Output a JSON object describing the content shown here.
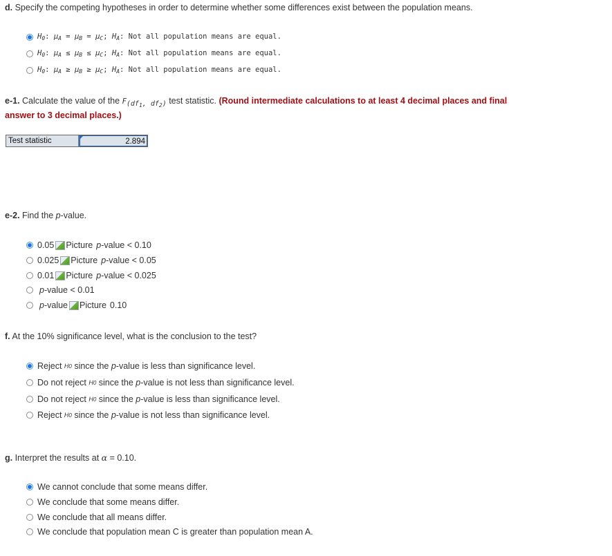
{
  "part_d": {
    "label": "d.",
    "question": " Specify the competing hypotheses in order to determine whether some differences exist between the population means.",
    "options": [
      {
        "h0": "H",
        "op": "=",
        "ha_text": "Not all population means are equal.",
        "selected": true
      },
      {
        "h0": "H",
        "op": "≤",
        "ha_text": "Not all population means are equal.",
        "selected": false
      },
      {
        "h0": "H",
        "op": "≥",
        "ha_text": "Not all population means are equal.",
        "selected": false
      }
    ],
    "null_sub": "0",
    "alt_sub": "A",
    "mu": "μ",
    "groups": [
      "A",
      "B",
      "C"
    ]
  },
  "part_e1": {
    "label": "e-1.",
    "question_pre": " Calculate the value of the ",
    "f_symbol": "F",
    "f_args": "(df",
    "df1_sub": "1",
    "comma": ", df",
    "df2_sub": "2",
    "close": ")",
    "question_post": " test statistic. ",
    "instruction_line1": "(Round intermediate calculations to at least 4 decimal places and final",
    "instruction_line2": "answer to 3 decimal places.)",
    "table_label": "Test statistic",
    "table_value": "2.894"
  },
  "part_e2": {
    "label": "e-2.",
    "question_pre": " Find the ",
    "question_p": "p",
    "question_post": "-value.",
    "picture_alt": "Picture",
    "options": [
      {
        "pre": "0.05",
        "has_pic": true,
        "p": "p",
        "post": "-value < 0.10",
        "selected": true
      },
      {
        "pre": "0.025",
        "has_pic": true,
        "p": "p",
        "post": "-value < 0.05",
        "selected": false
      },
      {
        "pre": "0.01",
        "has_pic": true,
        "p": "p",
        "post": "-value < 0.025",
        "selected": false
      },
      {
        "pre": "",
        "has_pic": false,
        "p": "p",
        "post": "-value < 0.01",
        "selected": false
      },
      {
        "pre": "",
        "has_pic": true,
        "p": "p",
        "post": "-value",
        "tail": "0.10",
        "selected": false
      }
    ]
  },
  "part_f": {
    "label": "f.",
    "question": " At the 10% significance level, what is the conclusion to the test?",
    "options": [
      {
        "pre": "Reject ",
        "mid": " since the ",
        "post": "-value is less than significance level.",
        "selected": true
      },
      {
        "pre": "Do not reject ",
        "mid": " since the ",
        "post": "-value is not less than significance level.",
        "selected": false
      },
      {
        "pre": "Do not reject ",
        "mid": " since the ",
        "post": "-value is less than significance level.",
        "selected": false
      },
      {
        "pre": "Reject ",
        "mid": " since the ",
        "post": "-value is not less than significance level.",
        "selected": false
      }
    ]
  },
  "part_g": {
    "label": "g.",
    "question_pre": " Interpret the results at ",
    "alpha": "α",
    "question_post": " = 0.10.",
    "options": [
      {
        "text": "We cannot conclude that some means differ.",
        "selected": true
      },
      {
        "text": "We conclude that some means differ.",
        "selected": false
      },
      {
        "text": "We conclude that all means differ.",
        "selected": false
      },
      {
        "text": "We conclude that population mean C is greater than population mean A.",
        "selected": false
      }
    ]
  },
  "colors": {
    "instruction_red": "#a10f12",
    "radio_selected": "#1a73e8",
    "input_bg": "#dde3ea"
  }
}
